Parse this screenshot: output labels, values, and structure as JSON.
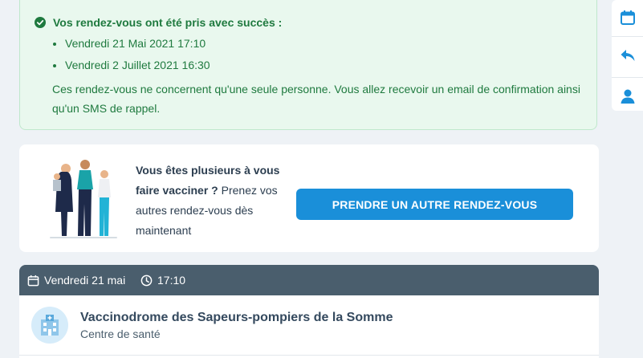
{
  "alert": {
    "title": "Vos rendez-vous ont été pris avec succès :",
    "appointments": [
      "Vendredi 21 Mai 2021 17:10",
      "Vendredi 2 Juillet 2021 16:30"
    ],
    "note": "Ces rendez-vous ne concernent qu'une seule personne. Vous allez recevoir un email de confirmation ainsi qu'un SMS de rappel."
  },
  "invite": {
    "bold_text": "Vous êtes plusieurs à vous faire vacciner ?",
    "text": " Prenez vos autres rendez-vous dès maintenant",
    "button_label": "PRENDRE UN AUTRE RENDEZ-VOUS"
  },
  "appointment": {
    "date": "Vendredi 21 mai",
    "time": "17:10",
    "center_name": "Vaccinodrome des Sapeurs-pompiers de la Somme",
    "center_type": "Centre de santé"
  },
  "toolbar": {
    "icons": [
      "calendar-icon",
      "reply-icon",
      "user-icon"
    ]
  },
  "colors": {
    "success_bg": "#e9f8ee",
    "success_text": "#1f7a3f",
    "primary": "#1a8fd9",
    "header_bg": "#4a5e6d",
    "page_bg": "#eef2f6"
  }
}
